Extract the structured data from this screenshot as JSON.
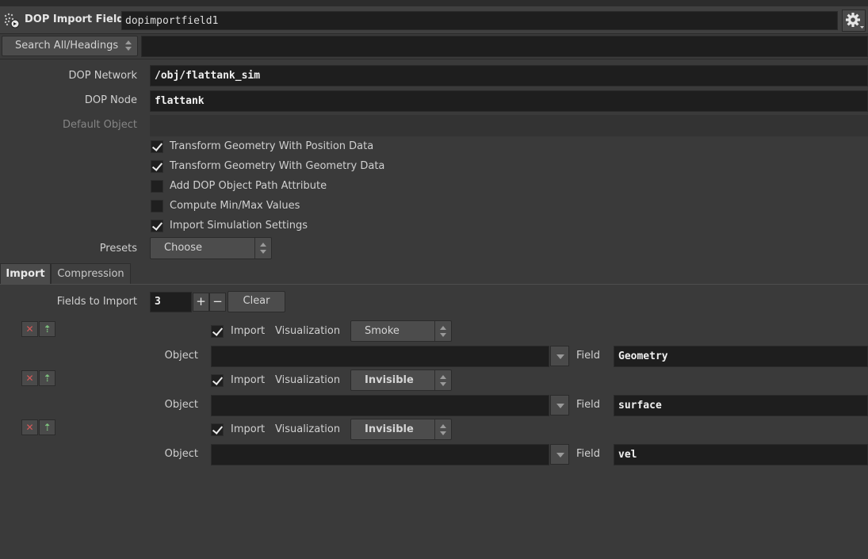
{
  "header": {
    "node_type": "DOP Import Fields",
    "node_name": "dopimportfield1",
    "icons": [
      "node-type-icon",
      "gear-icon"
    ]
  },
  "search": {
    "mode_label": "Search All/Headings",
    "value": ""
  },
  "params": {
    "dop_network": {
      "label": "DOP Network",
      "value": "/obj/flattank_sim"
    },
    "dop_node": {
      "label": "DOP Node",
      "value": "flattank"
    },
    "default_object": {
      "label": "Default Object",
      "value": ""
    },
    "toggles": [
      {
        "label": "Transform Geometry With Position Data",
        "checked": true
      },
      {
        "label": "Transform Geometry With Geometry Data",
        "checked": true
      },
      {
        "label": "Add DOP Object Path Attribute",
        "checked": false
      },
      {
        "label": "Compute Min/Max Values",
        "checked": false
      },
      {
        "label": "Import Simulation Settings",
        "checked": true
      }
    ],
    "presets": {
      "label": "Presets",
      "value": "Choose"
    }
  },
  "tabs": [
    {
      "label": "Import",
      "active": true
    },
    {
      "label": "Compression",
      "active": false
    }
  ],
  "import": {
    "fields_label": "Fields to Import",
    "count": "3",
    "plus": "+",
    "minus": "−",
    "clear_label": "Clear",
    "import_label": "Import",
    "visualization_label": "Visualization",
    "object_label": "Object",
    "field_label": "Field",
    "entries": [
      {
        "import": true,
        "visualization": "Smoke",
        "object": "",
        "field": "Geometry"
      },
      {
        "import": true,
        "visualization": "Invisible",
        "object": "",
        "field": "surface"
      },
      {
        "import": true,
        "visualization": "Invisible",
        "object": "",
        "field": "vel"
      }
    ]
  },
  "colors": {
    "background": "#3a3a3a",
    "field_bg": "#1e1e1e",
    "button_bg": "#4c4c4c",
    "remove_icon": "#d65a5a",
    "move_up_icon": "#7fc27f"
  }
}
